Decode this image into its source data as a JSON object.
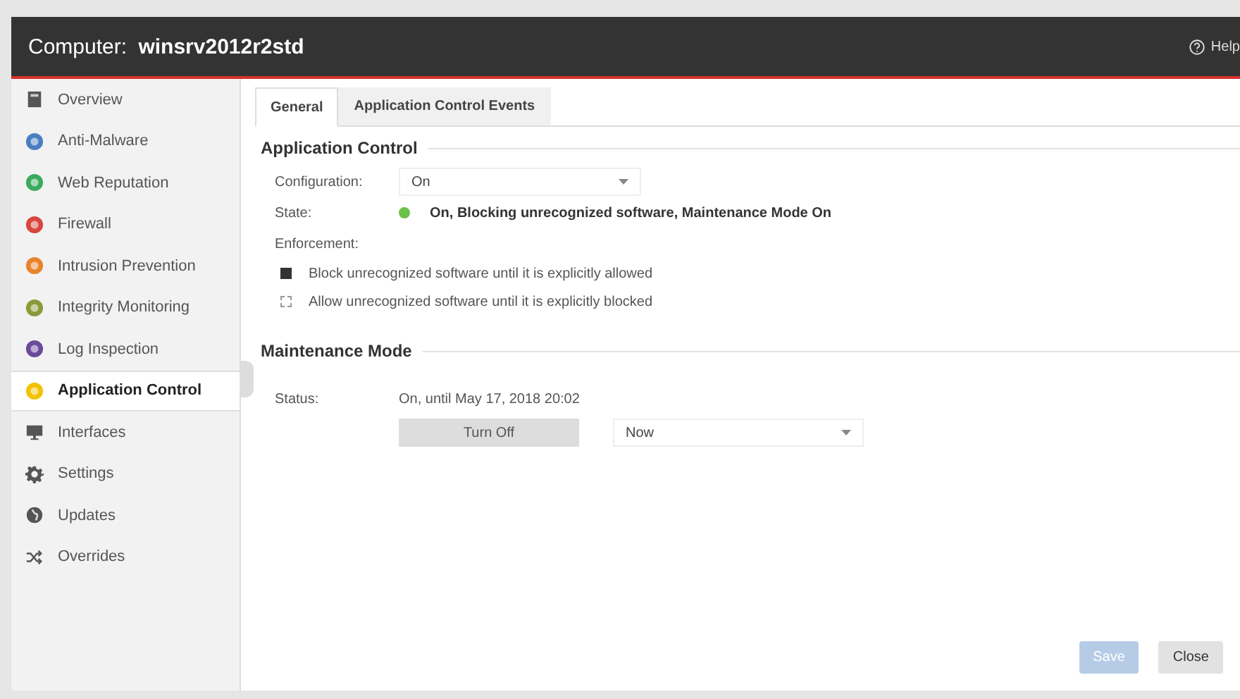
{
  "window": {
    "title_prefix": "Computer:",
    "title_name": "winsrv2012r2std",
    "help": "Help"
  },
  "sidebar": {
    "items": [
      {
        "label": "Overview",
        "kind": "document",
        "selected": false
      },
      {
        "label": "Anti-Malware",
        "kind": "circle",
        "color": "#4a7fc1",
        "selected": false
      },
      {
        "label": "Web Reputation",
        "kind": "circle",
        "color": "#3aaa5c",
        "selected": false
      },
      {
        "label": "Firewall",
        "kind": "circle",
        "color": "#d9463e",
        "selected": false
      },
      {
        "label": "Intrusion Prevention",
        "kind": "circle",
        "color": "#e8832a",
        "selected": false
      },
      {
        "label": "Integrity Monitoring",
        "kind": "circle",
        "color": "#8a9a3a",
        "selected": false
      },
      {
        "label": "Log Inspection",
        "kind": "circle",
        "color": "#6a4a9a",
        "selected": false
      },
      {
        "label": "Application Control",
        "kind": "circle",
        "color": "#f2c200",
        "selected": true
      },
      {
        "label": "Interfaces",
        "kind": "monitor",
        "selected": false
      },
      {
        "label": "Settings",
        "kind": "gear",
        "selected": false
      },
      {
        "label": "Updates",
        "kind": "globe",
        "selected": false
      },
      {
        "label": "Overrides",
        "kind": "shuffle",
        "selected": false
      }
    ]
  },
  "tabs": [
    {
      "label": "General",
      "selected": true
    },
    {
      "label": "Application Control Events",
      "selected": false
    }
  ],
  "application_control": {
    "heading": "Application Control",
    "configuration_label": "Configuration:",
    "configuration_value": "On",
    "state_label": "State:",
    "state_text": "On, Blocking unrecognized software, Maintenance Mode On",
    "enforcement_label": "Enforcement:",
    "enforcement_options": [
      {
        "label": "Block unrecognized software until it is explicitly allowed",
        "selected": true
      },
      {
        "label": "Allow unrecognized software until it is explicitly blocked",
        "selected": false
      }
    ]
  },
  "maintenance_mode": {
    "heading": "Maintenance Mode",
    "status_label": "Status:",
    "status_value": "On, until May 17, 2018 20:02",
    "turn_off_button": "Turn Off",
    "duration_value": "Now"
  },
  "buttons": [
    {
      "label": "Save",
      "disabled": true
    },
    {
      "label": "Close",
      "disabled": false
    }
  ]
}
